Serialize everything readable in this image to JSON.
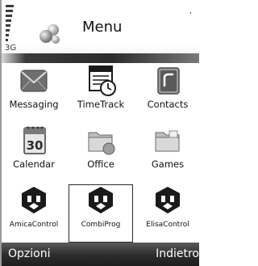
{
  "header": {
    "title": "Menu",
    "network": "3G",
    "corner_mark": "ʻ",
    "icon": "menu-balls-icon"
  },
  "grid": {
    "items": [
      {
        "label": "Messaging",
        "icon": "envelope-icon"
      },
      {
        "label": "TimeTrack",
        "icon": "calendar-clock-icon"
      },
      {
        "label": "Contacts",
        "icon": "contacts-card-icon"
      },
      {
        "label": "Calendar",
        "icon": "calendar-30-icon"
      },
      {
        "label": "Office",
        "icon": "folder-office-icon"
      },
      {
        "label": "Games",
        "icon": "folder-games-icon"
      },
      {
        "label": "AmicaControl",
        "icon": "robot-shield-icon"
      },
      {
        "label": "CombiProg",
        "icon": "robot-shield-icon"
      },
      {
        "label": "ElisaControl",
        "icon": "robot-shield-icon"
      }
    ],
    "selected_index": 7
  },
  "softkeys": {
    "left": "Opzioni",
    "right": "Indietro"
  },
  "colors": {
    "header_band": "#2b2b2b",
    "softkey_bg": "#2c2c2c",
    "selection_border": "#2a2a2a"
  }
}
